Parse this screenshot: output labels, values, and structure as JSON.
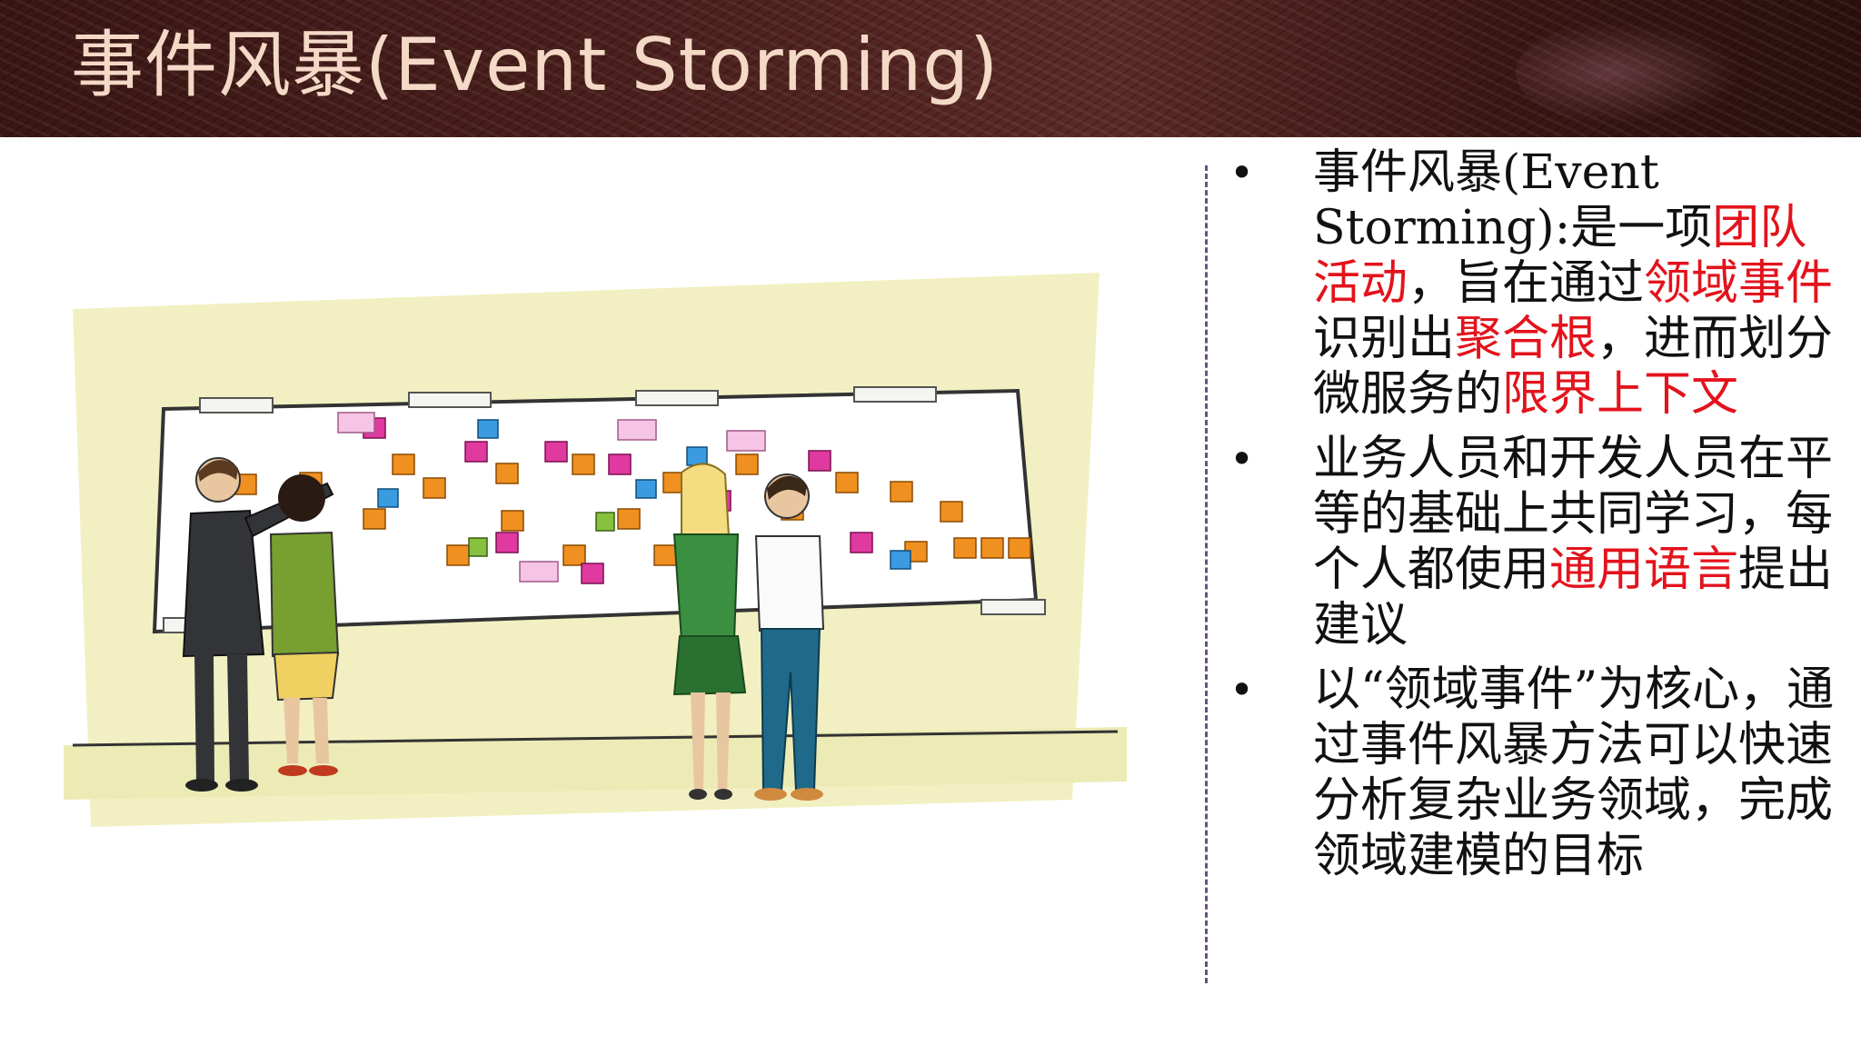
{
  "slide": {
    "title": "事件风暴(Event Storming)"
  },
  "bullets": [
    {
      "parts": [
        {
          "text": "事件风暴(Event Storming):是一项",
          "highlight": false
        },
        {
          "text": "团队活动",
          "highlight": true
        },
        {
          "text": "，旨在通过",
          "highlight": false
        },
        {
          "text": "领域事件",
          "highlight": true
        },
        {
          "text": "识别出",
          "highlight": false
        },
        {
          "text": "聚合根",
          "highlight": true
        },
        {
          "text": "，进而划分微服务的",
          "highlight": false
        },
        {
          "text": "限界上下文",
          "highlight": true
        }
      ]
    },
    {
      "parts": [
        {
          "text": "业务人员和开发人员在平等的基础上共同学习，每个人都使用",
          "highlight": false
        },
        {
          "text": "通用语言",
          "highlight": true
        },
        {
          "text": "提出建议",
          "highlight": false
        }
      ]
    },
    {
      "parts": [
        {
          "text": "以“领域事件”为核心，通过事件风暴方法可以快速分析复杂业务领域，完成领域建模的目标",
          "highlight": false
        }
      ]
    }
  ],
  "colors": {
    "title": "#f4d9c7",
    "highlight": "#e3131c",
    "text": "#111111",
    "divider": "#6b4f88"
  },
  "icons": {
    "bullet": "bullet-dot-icon"
  }
}
